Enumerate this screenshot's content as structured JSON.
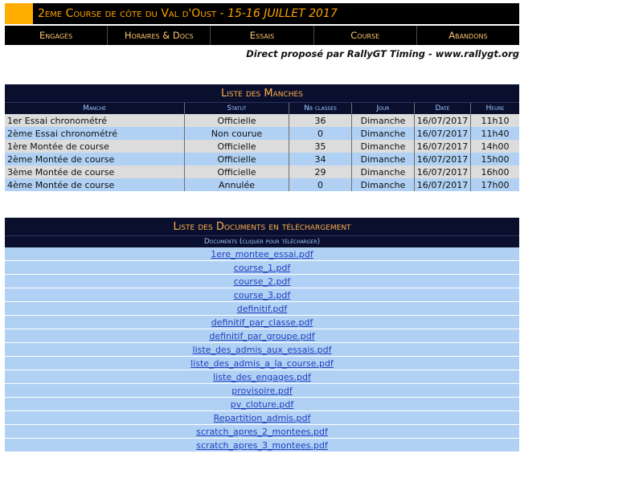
{
  "header": {
    "title": "2eme Course de côte du Val d'Oust",
    "separator": " - ",
    "dates": "15-16 JUILLET 2017"
  },
  "nav": [
    {
      "label": "Engagés"
    },
    {
      "label": "Horaires & Docs"
    },
    {
      "label": "Essais"
    },
    {
      "label": "Course"
    },
    {
      "label": "Abandons"
    }
  ],
  "credit": "Direct proposé par RallyGT Timing - www.rallygt.org",
  "manches": {
    "title": "Liste des Manches",
    "columns": [
      "Manche",
      "Statut",
      "Nb classes",
      "Jour",
      "Date",
      "Heure"
    ],
    "rows": [
      {
        "manche": "1er Essai chronométré",
        "statut": "Officielle",
        "nb": "36",
        "jour": "Dimanche",
        "date": "16/07/2017",
        "heure": "11h10"
      },
      {
        "manche": "2ème Essai chronométré",
        "statut": "Non courue",
        "nb": "0",
        "jour": "Dimanche",
        "date": "16/07/2017",
        "heure": "11h40"
      },
      {
        "manche": "1ère Montée de course",
        "statut": "Officielle",
        "nb": "35",
        "jour": "Dimanche",
        "date": "16/07/2017",
        "heure": "14h00"
      },
      {
        "manche": "2ème Montée de course",
        "statut": "Officielle",
        "nb": "34",
        "jour": "Dimanche",
        "date": "16/07/2017",
        "heure": "15h00"
      },
      {
        "manche": "3ème Montée de course",
        "statut": "Officielle",
        "nb": "29",
        "jour": "Dimanche",
        "date": "16/07/2017",
        "heure": "16h00"
      },
      {
        "manche": "4ème Montée de course",
        "statut": "Annulée",
        "nb": "0",
        "jour": "Dimanche",
        "date": "16/07/2017",
        "heure": "17h00"
      }
    ]
  },
  "documents": {
    "title": "Liste des Documents en téléchargement",
    "column": "Documents (cliquer pour télécharger)",
    "files": [
      "1ere_montee_essai.pdf",
      "course_1.pdf",
      "course_2.pdf",
      "course_3.pdf",
      "definitif.pdf",
      "definitif_par_classe.pdf",
      "definitif_par_groupe.pdf",
      "liste_des_admis_aux_essais.pdf",
      "liste_des_admis_a_la_course.pdf",
      "liste_des_engages.pdf",
      "provisoire.pdf",
      "pv_cloture.pdf",
      "Repartition_admis.pdf",
      "scratch_apres_2_montees.pdf",
      "scratch_apres_3_montees.pdf"
    ]
  },
  "colors": {
    "accent": "#ffae00",
    "title_text": "#ffa200",
    "nav_bg": "#000000",
    "panel_bg": "#0a0f2e",
    "row_grey": "#dcdcdc",
    "row_blue": "#b0d1f4",
    "link": "#1f3fbf"
  }
}
